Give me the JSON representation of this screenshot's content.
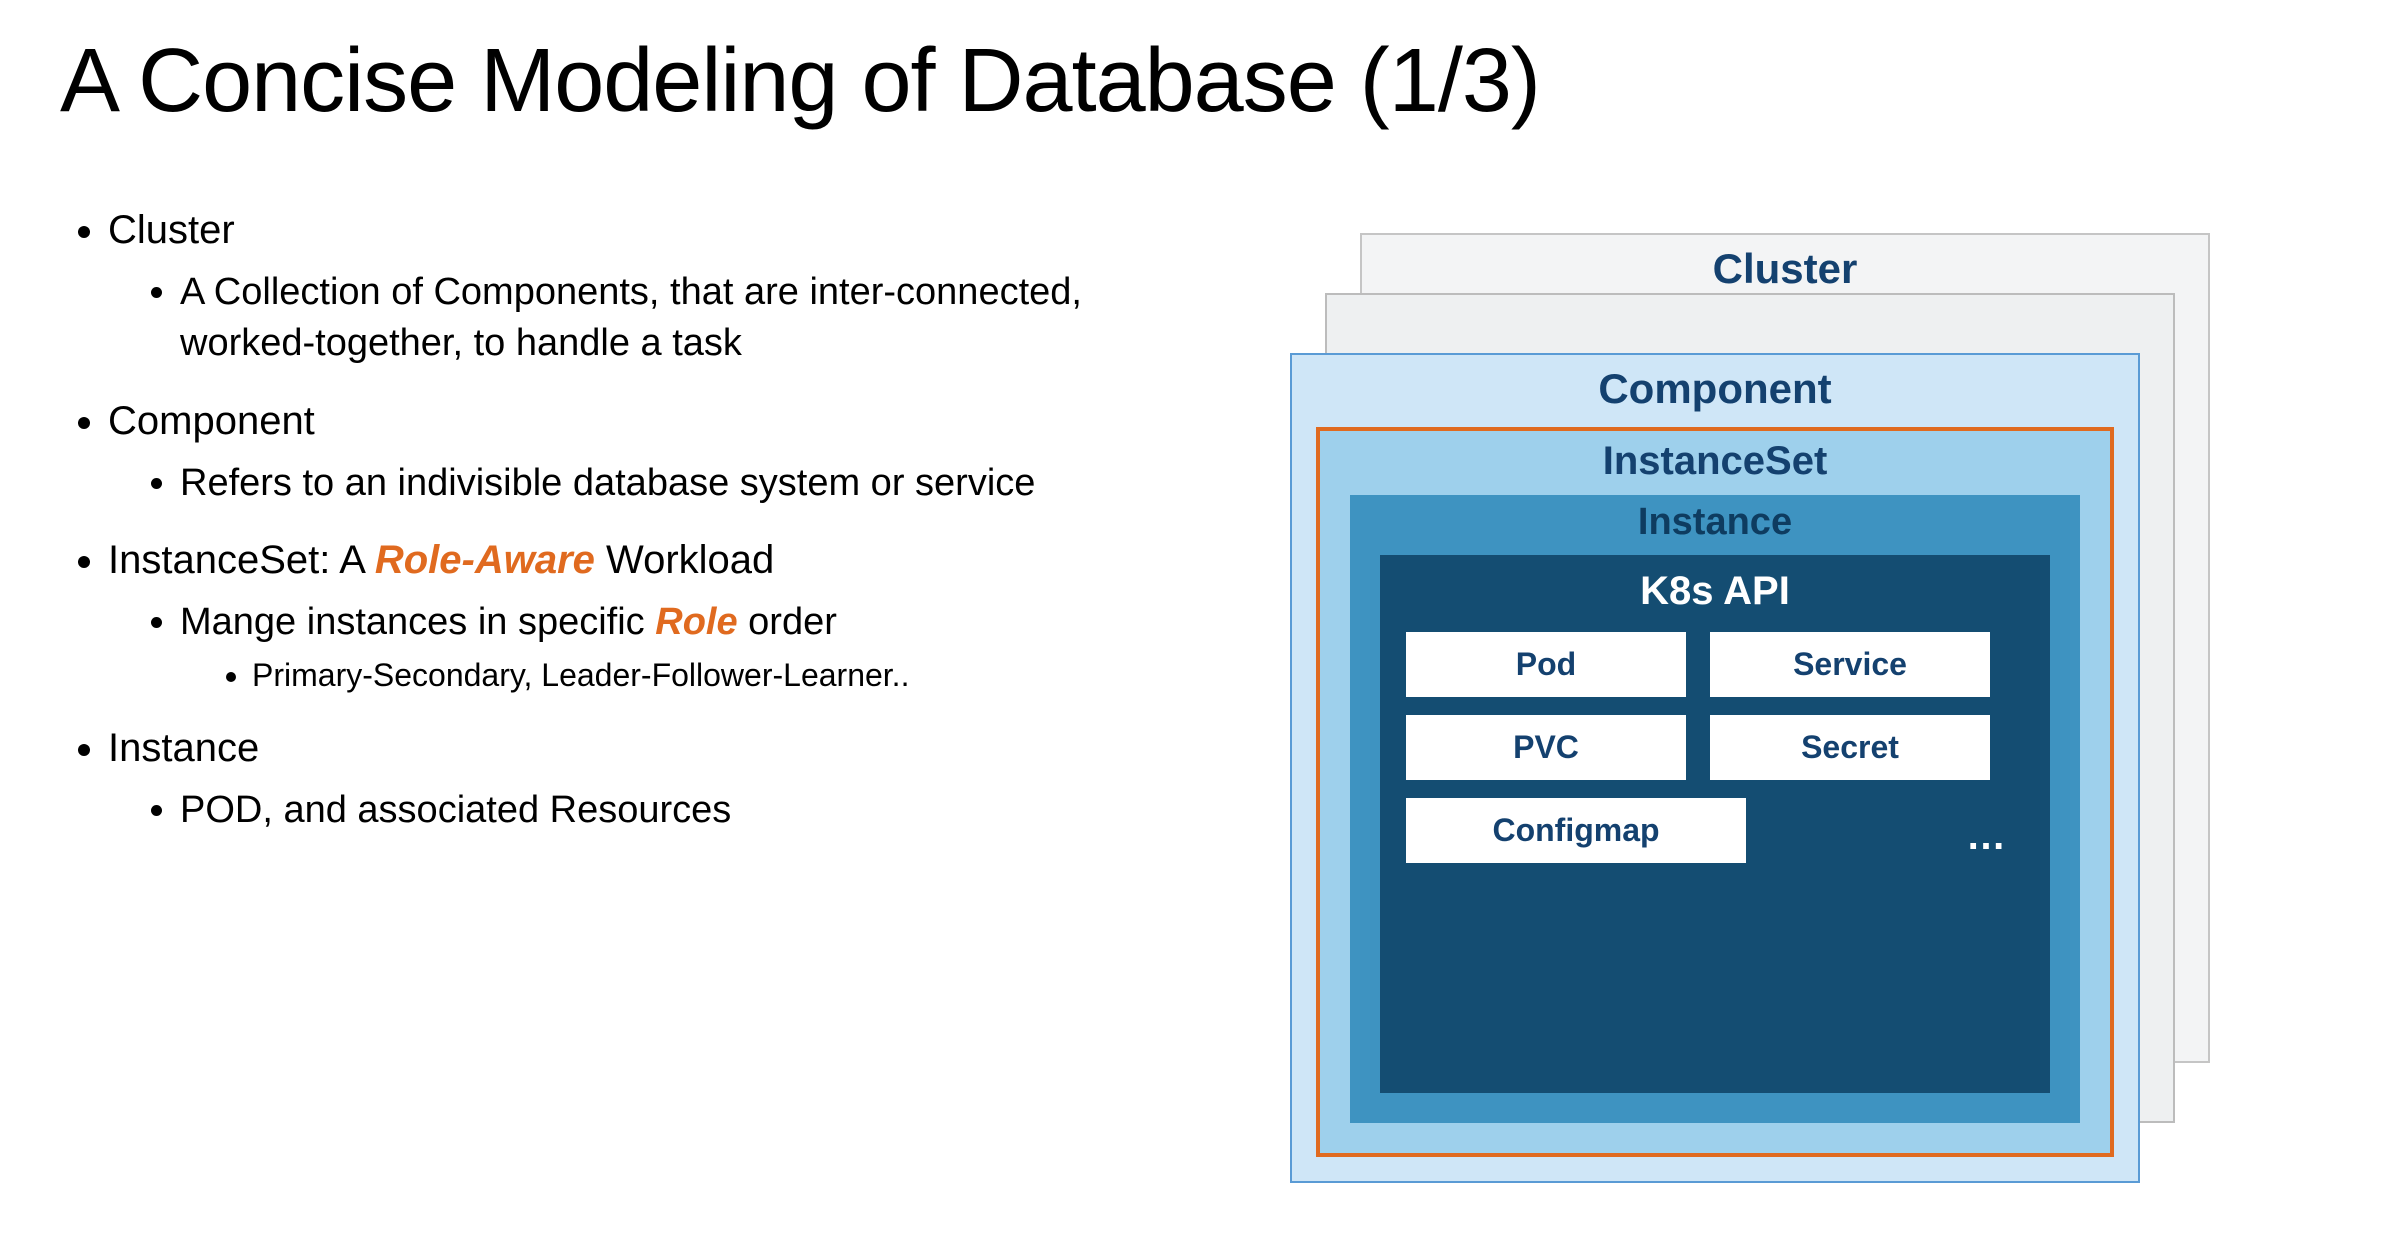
{
  "title": "A Concise Modeling of Database (1/3)",
  "bullets": {
    "cluster": {
      "title": "Cluster",
      "desc": "A Collection of Components, that are inter-connected, worked-together, to handle a task"
    },
    "component": {
      "title": "Component",
      "desc": "Refers to an indivisible database system or service"
    },
    "instanceset": {
      "title_prefix": "InstanceSet: A ",
      "title_emph": "Role-Aware",
      "title_suffix": " Workload",
      "sub_prefix": "Mange instances in specific ",
      "sub_emph": "Role",
      "sub_suffix": " order",
      "subsub": "Primary-Secondary, Leader-Follower-Learner.."
    },
    "instance": {
      "title": "Instance",
      "desc": "POD, and associated Resources"
    }
  },
  "diagram": {
    "cluster": "Cluster",
    "component": "Component",
    "instanceset": "InstanceSet",
    "instance": "Instance",
    "k8s": "K8s API",
    "api_items": {
      "pod": "Pod",
      "service": "Service",
      "pvc": "PVC",
      "secret": "Secret",
      "configmap": "Configmap"
    },
    "ellipsis": "…"
  },
  "colors": {
    "accent_orange": "#e06a1f",
    "deep_blue": "#14416f"
  }
}
